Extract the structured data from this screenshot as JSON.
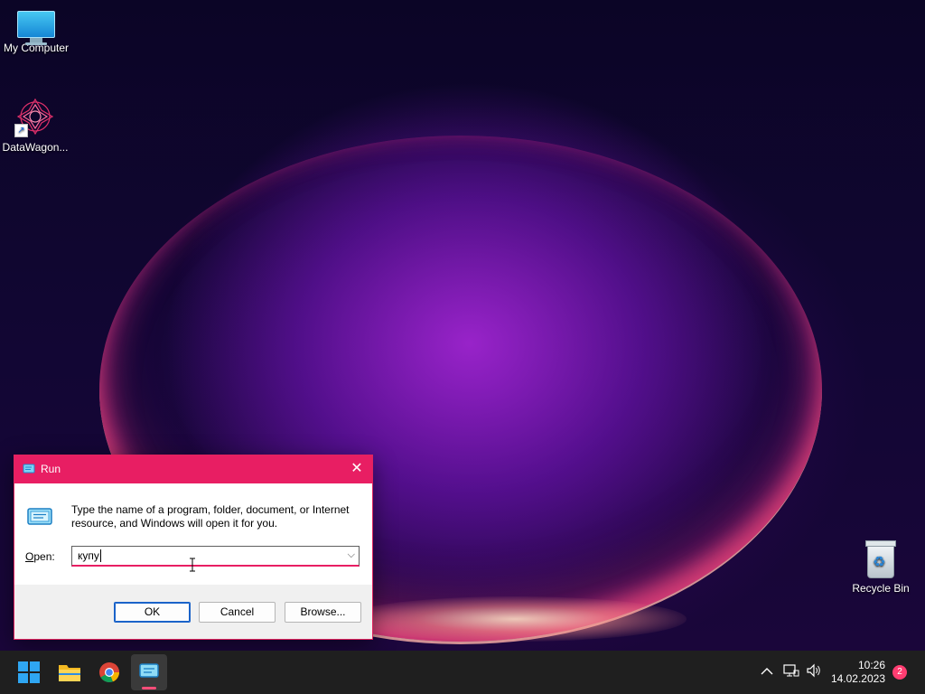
{
  "desktop": {
    "icons": [
      {
        "label": "My Computer",
        "icon": "monitor-icon"
      },
      {
        "label": "DataWagon...",
        "icon": "datawagon-icon"
      },
      {
        "label": "Recycle Bin",
        "icon": "recycle-bin-icon"
      }
    ]
  },
  "run_dialog": {
    "title": "Run",
    "close_glyph": "✕",
    "description": "Type the name of a program, folder, document, or Internet resource, and Windows will open it for you.",
    "open_label_accel": "O",
    "open_label_rest": "pen:",
    "input_value": "купу",
    "dropdown_glyph": "⌵",
    "buttons": {
      "ok": "OK",
      "cancel": "Cancel",
      "browse": "Browse..."
    }
  },
  "taskbar": {
    "apps": [
      {
        "name": "start",
        "icon": "windows-start-icon"
      },
      {
        "name": "file-explorer",
        "icon": "folder-icon"
      },
      {
        "name": "chrome",
        "icon": "chrome-icon"
      },
      {
        "name": "run",
        "icon": "run-icon",
        "active": true
      }
    ],
    "tray": {
      "chevron": "^",
      "time": "10:26",
      "date": "14.02.2023",
      "notification_count": "2"
    }
  },
  "colors": {
    "accent": "#e81e63",
    "taskbar": "#1f1f1f",
    "notification": "#ff3d71"
  }
}
